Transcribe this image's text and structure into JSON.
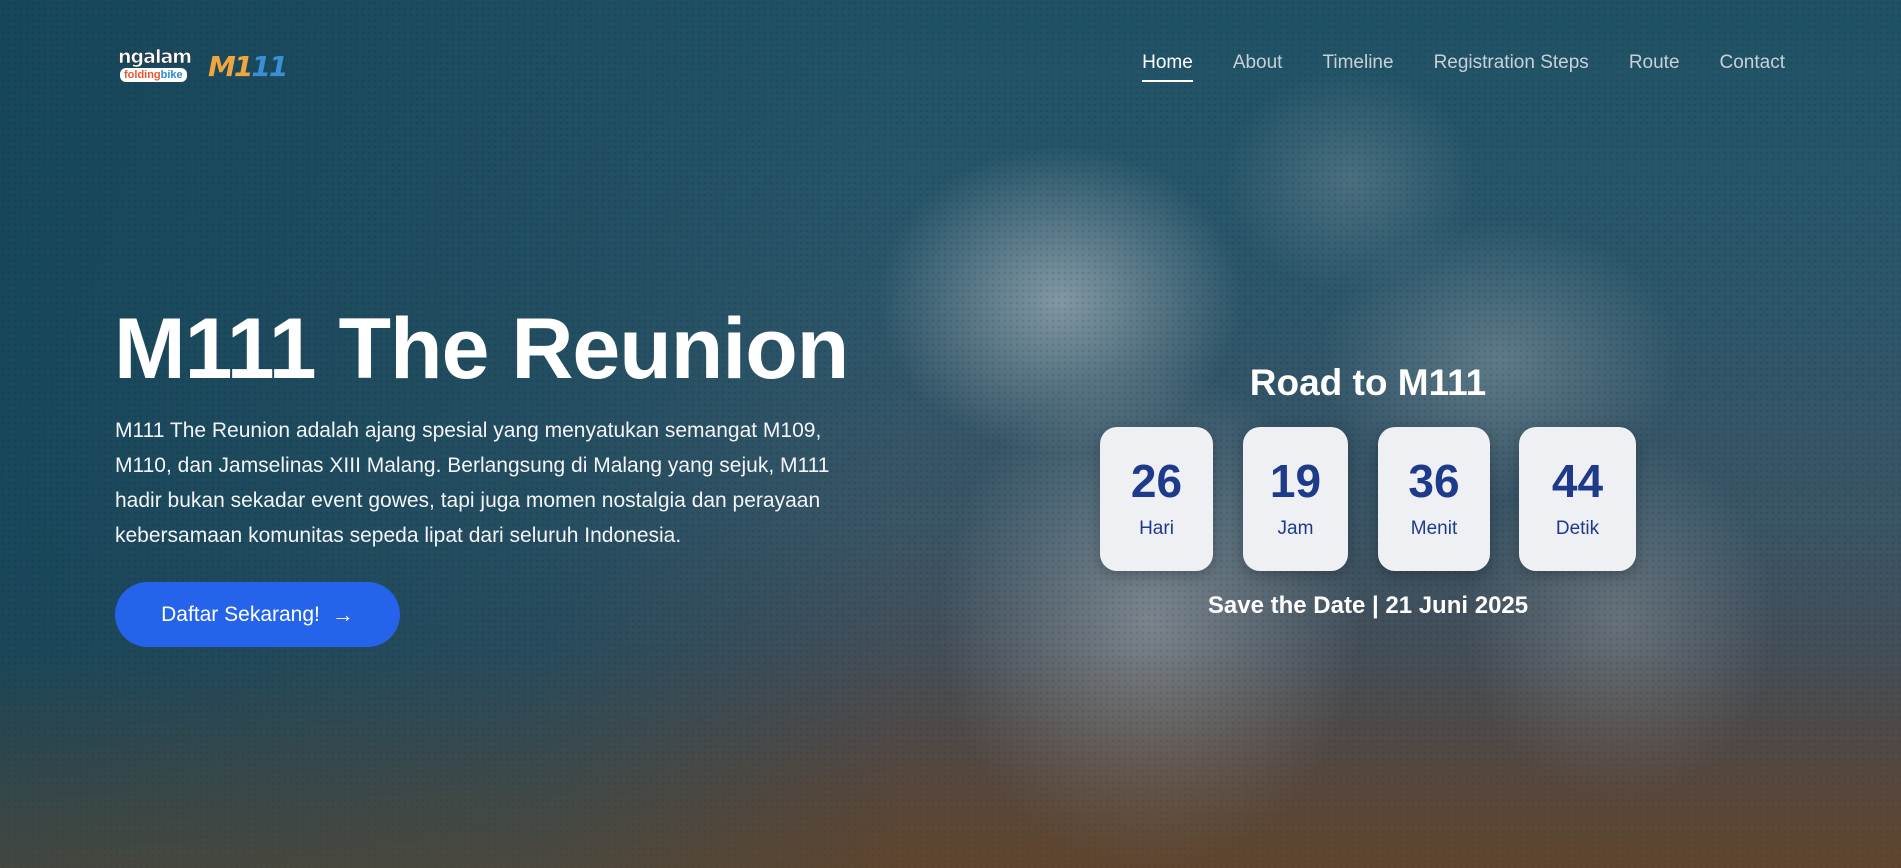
{
  "nav": {
    "logo_primary": {
      "top": "ngalam",
      "bottom_a": "folding",
      "bottom_b": "bike"
    },
    "logo_secondary": {
      "mark_a": "M1",
      "mark_b": "11"
    },
    "items": [
      {
        "label": "Home",
        "active": true
      },
      {
        "label": "About",
        "active": false
      },
      {
        "label": "Timeline",
        "active": false
      },
      {
        "label": "Registration Steps",
        "active": false
      },
      {
        "label": "Route",
        "active": false
      },
      {
        "label": "Contact",
        "active": false
      }
    ]
  },
  "hero": {
    "title": "M111 The Reunion",
    "description": "M111 The Reunion adalah ajang spesial yang menyatukan semangat M109, M110, dan Jamselinas XIII Malang. Berlangsung di Malang yang sejuk, M111 hadir bukan sekadar event gowes, tapi juga momen nostalgia dan perayaan kebersamaan komunitas sepeda lipat dari seluruh Indonesia.",
    "cta_label": "Daftar Sekarang!",
    "cta_icon": "arrow-right-icon"
  },
  "countdown": {
    "heading": "Road to M111",
    "units": [
      {
        "value": "26",
        "label": "Hari"
      },
      {
        "value": "19",
        "label": "Jam"
      },
      {
        "value": "36",
        "label": "Menit"
      },
      {
        "value": "44",
        "label": "Detik"
      }
    ],
    "save_the_date": "Save the Date | 21 Juni 2025"
  },
  "colors": {
    "accent": "#2563eb",
    "countdown_number": "#1e3a8a",
    "countdown_box": "#eef0f3"
  }
}
